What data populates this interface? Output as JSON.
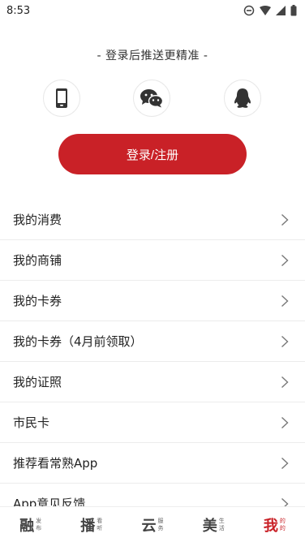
{
  "status_bar": {
    "time": "8:53"
  },
  "tagline": "- 登录后推送更精准 -",
  "login_button": "登录/注册",
  "menu": [
    {
      "label": "我的消费"
    },
    {
      "label": "我的商铺"
    },
    {
      "label": "我的卡券"
    },
    {
      "label": "我的卡券（4月前领取）"
    },
    {
      "label": "我的证照"
    },
    {
      "label": "市民卡"
    },
    {
      "label": "推荐看常熟App"
    },
    {
      "label": "App意见反馈"
    }
  ],
  "tabs": [
    {
      "big": "融",
      "small1": "发",
      "small2": "布"
    },
    {
      "big": "播",
      "small1": "看",
      "small2": "听"
    },
    {
      "big": "云",
      "small1": "服",
      "small2": "务"
    },
    {
      "big": "美",
      "small1": "生",
      "small2": "活"
    },
    {
      "big": "我",
      "small1": "的",
      "small2": "的"
    }
  ],
  "colors": {
    "accent": "#c92127"
  }
}
